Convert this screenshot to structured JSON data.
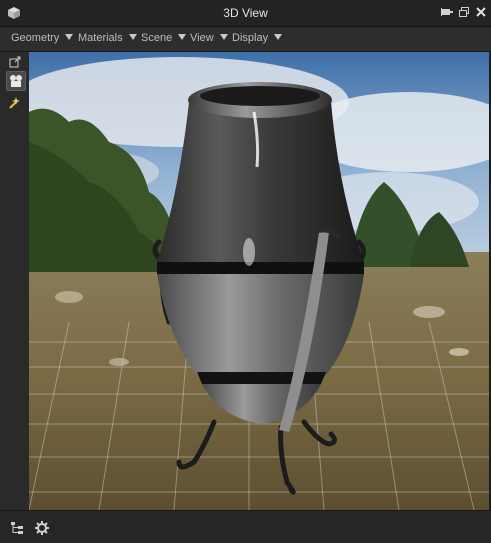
{
  "window": {
    "title": "3D View"
  },
  "menus": [
    {
      "label": "Geometry"
    },
    {
      "label": "Materials"
    },
    {
      "label": "Scene"
    },
    {
      "label": "View"
    },
    {
      "label": "Display"
    }
  ],
  "title_buttons": [
    "pin-icon",
    "float-window-icon",
    "close-icon"
  ],
  "left_tools": [
    "export-icon",
    "camera-tool-icon",
    "light-tool-icon"
  ],
  "bottom_tools": [
    "scene-tree-icon",
    "settings-gear-icon"
  ],
  "colors": {
    "panel": "#2a2a2a",
    "titlebar": "#232323",
    "text": "#bdbdbd",
    "sky": "#6a8fb8",
    "ground": "#8a7a52"
  }
}
